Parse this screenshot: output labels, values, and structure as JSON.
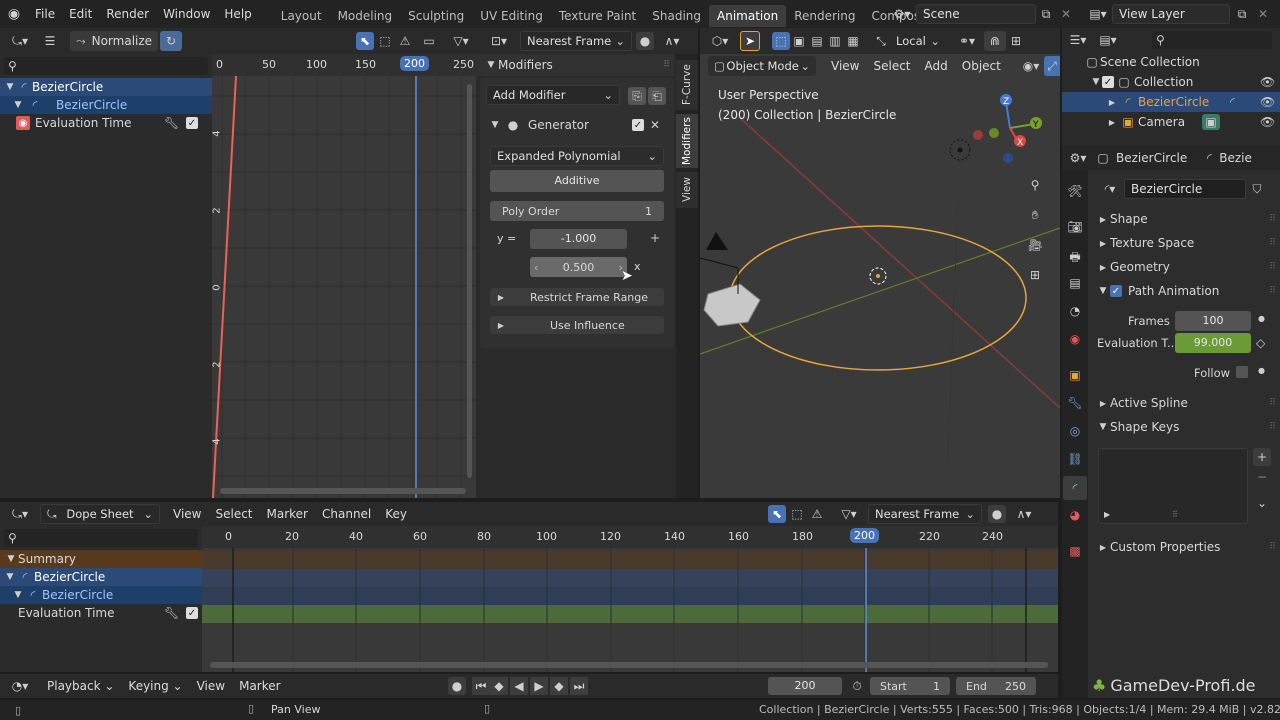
{
  "top_menu": [
    "File",
    "Edit",
    "Render",
    "Window",
    "Help"
  ],
  "workspaces": [
    "Layout",
    "Modeling",
    "Sculpting",
    "UV Editing",
    "Texture Paint",
    "Shading",
    "Animation",
    "Rendering",
    "Compositing"
  ],
  "active_workspace": "Animation",
  "scene": "Scene",
  "view_layer": "View Layer",
  "graph": {
    "normalize_label": "Normalize",
    "snap": "Nearest Frame",
    "ruler": [
      "0",
      "50",
      "100",
      "150",
      "200",
      "250"
    ],
    "current_frame": "200",
    "y_ticks": [
      "4",
      "2",
      "0",
      "2",
      "4"
    ],
    "channels": [
      {
        "label": "BezierCircle",
        "level": 0
      },
      {
        "label": "BezierCircle",
        "level": 1
      },
      {
        "label": "Evaluation Time",
        "level": 2
      }
    ]
  },
  "modifiers": {
    "title": "Modifiers",
    "add_modifier": "Add Modifier",
    "generator_label": "Generator",
    "mode": "Expanded Polynomial",
    "additive": "Additive",
    "poly_order_label": "Poly Order",
    "poly_order_value": "1",
    "y_eq": "y =",
    "coef0": "-1.000",
    "coef1": "0.500",
    "x_label": "x",
    "restrict": "Restrict Frame Range",
    "influence": "Use Influence",
    "side_tabs": [
      "F-Curve",
      "Modifiers",
      "View"
    ]
  },
  "viewport": {
    "mode": "Object Mode",
    "menus": [
      "View",
      "Select",
      "Add",
      "Object"
    ],
    "orientation": "Local",
    "perspective": "User Perspective",
    "collection_info": "(200) Collection | BezierCircle",
    "accent_curve": "#e8a53a"
  },
  "outliner": {
    "root": "Scene Collection",
    "items": [
      {
        "label": "Collection",
        "level": 1
      },
      {
        "label": "BezierCircle",
        "level": 2,
        "selected": true
      },
      {
        "label": "Camera",
        "level": 2
      }
    ]
  },
  "properties": {
    "object_name": "BezierCircle",
    "breadcrumb_trailing": "Bezie",
    "data_name": "BezierCircle",
    "sections": [
      "Shape",
      "Texture Space",
      "Geometry"
    ],
    "path_animation": "Path Animation",
    "frames_label": "Frames",
    "frames_value": "100",
    "eval_label": "Evaluation T...",
    "eval_value": "99.000",
    "follow_label": "Follow",
    "after_sections": [
      "Active Spline",
      "Shape Keys"
    ],
    "custom": "Custom Properties",
    "eval_color": "#6b9b37"
  },
  "dopesheet": {
    "mode": "Dope Sheet",
    "menus": [
      "View",
      "Select",
      "Marker",
      "Channel",
      "Key"
    ],
    "snap": "Nearest Frame",
    "ruler": [
      "0",
      "20",
      "40",
      "60",
      "80",
      "100",
      "120",
      "140",
      "160",
      "180",
      "200",
      "220",
      "240"
    ],
    "current_frame": "200",
    "channels": [
      {
        "label": "Summary",
        "level": 0
      },
      {
        "label": "BezierCircle",
        "level": 0
      },
      {
        "label": "BezierCircle",
        "level": 1
      },
      {
        "label": "Evaluation Time",
        "level": 2
      }
    ]
  },
  "timeline": {
    "menus": [
      "Playback",
      "Keying",
      "View",
      "Marker"
    ],
    "frame": "200",
    "start_label": "Start",
    "start": "1",
    "end_label": "End",
    "end": "250"
  },
  "status": {
    "pan": "Pan View",
    "stats": "Collection | BezierCircle | Verts:555 | Faces:500 | Tris:968 | Objects:1/4 | Mem: 29.4 MiB | v2.82.7"
  },
  "watermark": "GameDev-Profi.de"
}
